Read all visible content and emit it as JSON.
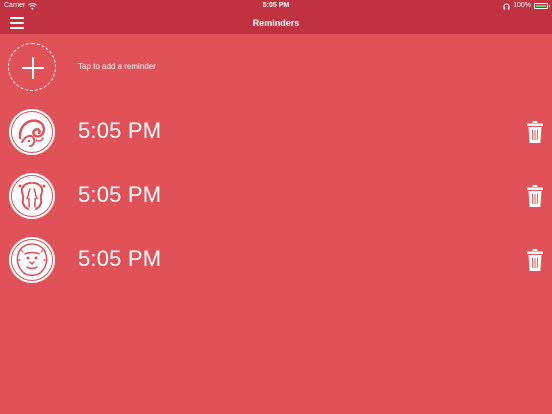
{
  "status_bar": {
    "carrier": "Carrier",
    "time": "5:05 PM",
    "battery": "100%",
    "icons": [
      "wifi-icon",
      "headphones-icon",
      "battery-icon"
    ]
  },
  "nav": {
    "title": "Reminders",
    "menu_icon": "hamburger-menu-icon"
  },
  "add_reminder": {
    "label": "Tap to add a reminder",
    "icon": "plus-icon"
  },
  "reminders": [
    {
      "time": "5:05 PM",
      "sign_icon": "aries-icon"
    },
    {
      "time": "5:05 PM",
      "sign_icon": "gemini-icon"
    },
    {
      "time": "5:05 PM",
      "sign_icon": "leo-icon"
    }
  ],
  "colors": {
    "background": "#e05158",
    "bar": "#c0323f",
    "foreground": "#ffffff"
  }
}
